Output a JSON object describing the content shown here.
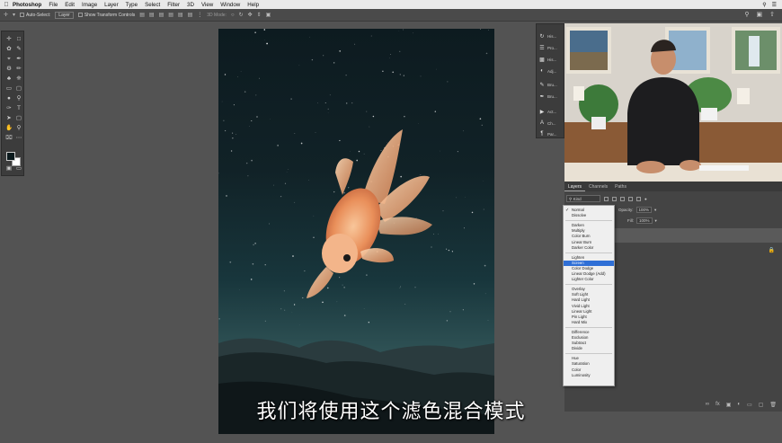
{
  "menubar": {
    "apple": "",
    "app_name": "Photoshop",
    "items": [
      "File",
      "Edit",
      "Image",
      "Layer",
      "Type",
      "Select",
      "Filter",
      "3D",
      "View",
      "Window",
      "Help"
    ]
  },
  "options_bar": {
    "auto_select_label": "Auto-Select:",
    "auto_select_value": "Layer",
    "show_transform_label": "Show Transform Controls",
    "mode_3d_label": "3D Mode:"
  },
  "collapsed_panels": [
    "His...",
    "Pro...",
    "His...",
    "Adj...",
    "Bru...",
    "Bru...",
    "Act...",
    "Ch...",
    "Par..."
  ],
  "layers_panel": {
    "tabs": [
      "Layers",
      "Channels",
      "Paths"
    ],
    "kind_label": "Kind",
    "opacity_label": "Opacity:",
    "opacity_value": "100%",
    "fill_label": "Fill:",
    "fill_value": "100%"
  },
  "blend_modes": {
    "selected": "Screen",
    "groups": [
      [
        "Normal",
        "Dissolve"
      ],
      [
        "Darken",
        "Multiply",
        "Color Burn",
        "Linear Burn",
        "Darker Color"
      ],
      [
        "Lighten",
        "Screen",
        "Color Dodge",
        "Linear Dodge (Add)",
        "Lighter Color"
      ],
      [
        "Overlay",
        "Soft Light",
        "Hard Light",
        "Vivid Light",
        "Linear Light",
        "Pin Light",
        "Hard Mix"
      ],
      [
        "Difference",
        "Exclusion",
        "Subtract",
        "Divide"
      ],
      [
        "Hue",
        "Saturation",
        "Color",
        "Luminosity"
      ]
    ]
  },
  "subtitle": "我们将使用这个滤色混合模式",
  "colors": {
    "accent": "#2f6fd6",
    "panel_bg": "#444444",
    "workspace_bg": "#535353",
    "foreground_color": "#0b1a1d",
    "background_color": "#ffffff"
  }
}
